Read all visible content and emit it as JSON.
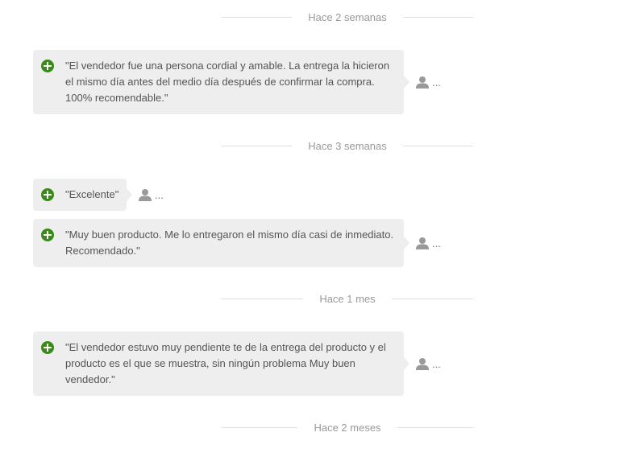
{
  "dividers": [
    {
      "label": "Hace 2 semanas"
    },
    {
      "label": "Hace 3 semanas"
    },
    {
      "label": "Hace 1 mes"
    },
    {
      "label": "Hace 2 meses"
    }
  ],
  "reviews": [
    {
      "text": "\"El vendedor fue una persona cordial y amable. La entrega la hicieron el mismo día antes del medio día después de confirmar la compra. 100% recomendable.\"",
      "author": "..."
    },
    {
      "text": "\"Excelente\"",
      "author": "..."
    },
    {
      "text": "\"Muy buen producto. Me lo entregaron el mismo día casi de inmediato. Recomendado.\"",
      "author": "..."
    },
    {
      "text": "\"El vendedor estuvo muy pendiente te de la entrega del producto y el producto es el que se muestra, sin ningún problema Muy buen vendedor.\"",
      "author": "..."
    }
  ],
  "colors": {
    "accent": "#3a8a1a",
    "bubble_bg": "#eeeeee",
    "divider_line": "#dddddd"
  },
  "icons": {
    "review_type": "plus-circle-icon",
    "author": "user-icon"
  }
}
